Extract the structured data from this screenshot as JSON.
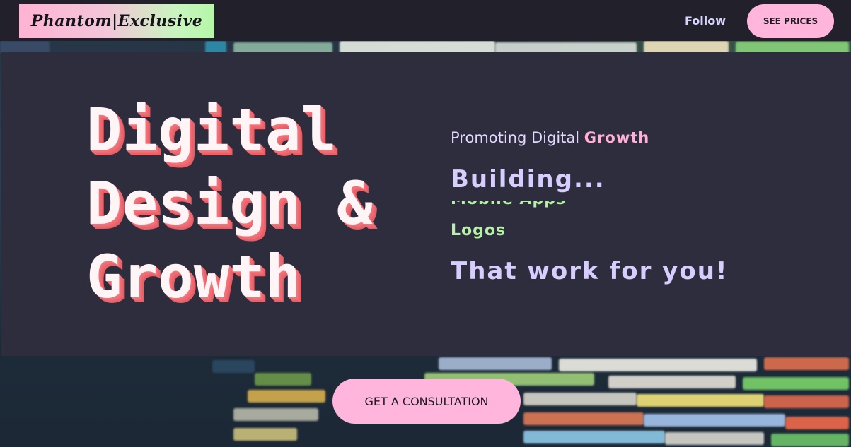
{
  "nav": {
    "logo_text": "Phantom|Exclusive",
    "follow_label": "Follow",
    "prices_label": "SEE PRICES"
  },
  "hero": {
    "title": "Digital\nDesign &\nGrowth",
    "tagline_prefix": "Promoting Digital ",
    "tagline_accent": "Growth",
    "building": "Building...",
    "rotating_items": [
      "Mobile Apps",
      "Logos"
    ],
    "closing": "That work for you!"
  },
  "cta": {
    "label": "GET A CONSULTATION"
  },
  "colors": {
    "page_bg": "#23222c",
    "panel_bg": "#2e2d3d",
    "accent_pink": "#ffb5dc",
    "title_shadow": "#f2737a",
    "lavender_text": "#d7cdff",
    "green_text": "#b5f2a5"
  }
}
